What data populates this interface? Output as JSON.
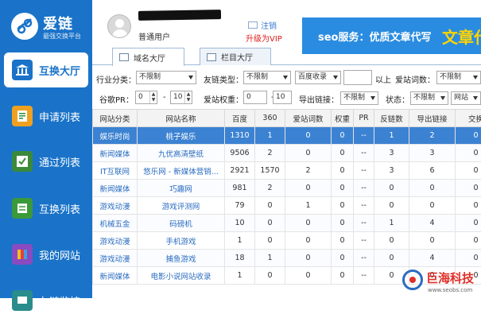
{
  "app": {
    "logo_title": "爱链",
    "logo_subtitle": "最强交换平台"
  },
  "sidebar": {
    "items": [
      {
        "label": "互换大厅",
        "icon": "hall-icon",
        "active": true
      },
      {
        "label": "申请列表",
        "icon": "apply-list-icon",
        "active": false
      },
      {
        "label": "通过列表",
        "icon": "check-list-icon",
        "active": false
      },
      {
        "label": "互换列表",
        "icon": "exchange-list-icon",
        "active": false
      },
      {
        "label": "我的网站",
        "icon": "my-sites-icon",
        "active": false
      },
      {
        "label": "友链监控",
        "icon": "monitor-icon",
        "active": false
      }
    ]
  },
  "header": {
    "user_role": "普通用户",
    "logout": "注销",
    "upgrade": "升级为VIP",
    "banner_text": "seo服务：优质文章代写",
    "banner_text2": "文章代"
  },
  "tabs": [
    {
      "label": "域名大厅",
      "active": true
    },
    {
      "label": "栏目大厅",
      "active": false
    }
  ],
  "filters": {
    "industry_label": "行业分类：",
    "industry_value": "不限制",
    "link_type_label": "友链类型：",
    "link_type_value": "不限制",
    "baidu_label": "百度收录",
    "baidu_input": "",
    "above_label": "以上",
    "love_words_label": "爱站词数：",
    "love_words_value": "不限制",
    "pr_label": "谷歌PR：",
    "pr_min": "0",
    "pr_max": "10",
    "weight_label": "爱站权重：",
    "weight_min": "0",
    "weight_max": "10",
    "export_label": "导出链接：",
    "export_value": "不限制",
    "status_label": "状态：",
    "status_value": "不限制",
    "site_label": "网站",
    "range_sep": "-"
  },
  "table": {
    "headers": [
      "网站分类",
      "网站名称",
      "百度",
      "360",
      "爱站词数",
      "权重",
      "PR",
      "反链数",
      "导出链接",
      "交换"
    ],
    "rows": [
      [
        "娱乐时尚",
        "桃子娱乐",
        "1310",
        "1",
        "0",
        "0",
        "--",
        "1",
        "2",
        "0"
      ],
      [
        "新闻媒体",
        "九优高清壁纸",
        "9506",
        "2",
        "0",
        "0",
        "--",
        "3",
        "3",
        "0"
      ],
      [
        "IT互联网",
        "悠乐网 - 新媒体营销...",
        "2921",
        "1570",
        "2",
        "0",
        "--",
        "3",
        "6",
        "0"
      ],
      [
        "新闻媒体",
        "巧趣网",
        "981",
        "2",
        "0",
        "0",
        "--",
        "0",
        "0",
        "0"
      ],
      [
        "游戏动漫",
        "游戏评测网",
        "79",
        "0",
        "1",
        "0",
        "--",
        "0",
        "0",
        "0"
      ],
      [
        "机械五金",
        "码磅机",
        "10",
        "0",
        "0",
        "0",
        "--",
        "1",
        "4",
        "0"
      ],
      [
        "游戏动漫",
        "手机游戏",
        "1",
        "0",
        "0",
        "0",
        "--",
        "0",
        "0",
        "0"
      ],
      [
        "游戏动漫",
        "捕鱼游戏",
        "18",
        "1",
        "0",
        "0",
        "--",
        "0",
        "4",
        "0"
      ],
      [
        "新闻媒体",
        "电影小说网站收录",
        "1",
        "0",
        "0",
        "0",
        "--",
        "0",
        "0",
        "0"
      ]
    ],
    "selected_row": 0
  },
  "watermark": {
    "text": "巨海科技",
    "url": "www.seobs.com"
  },
  "colors": {
    "sidebar_bg": "#1a73c8",
    "selected_row": "#3c82d2",
    "link_blue": "#2a6cc0",
    "vip_red": "#e02020"
  }
}
